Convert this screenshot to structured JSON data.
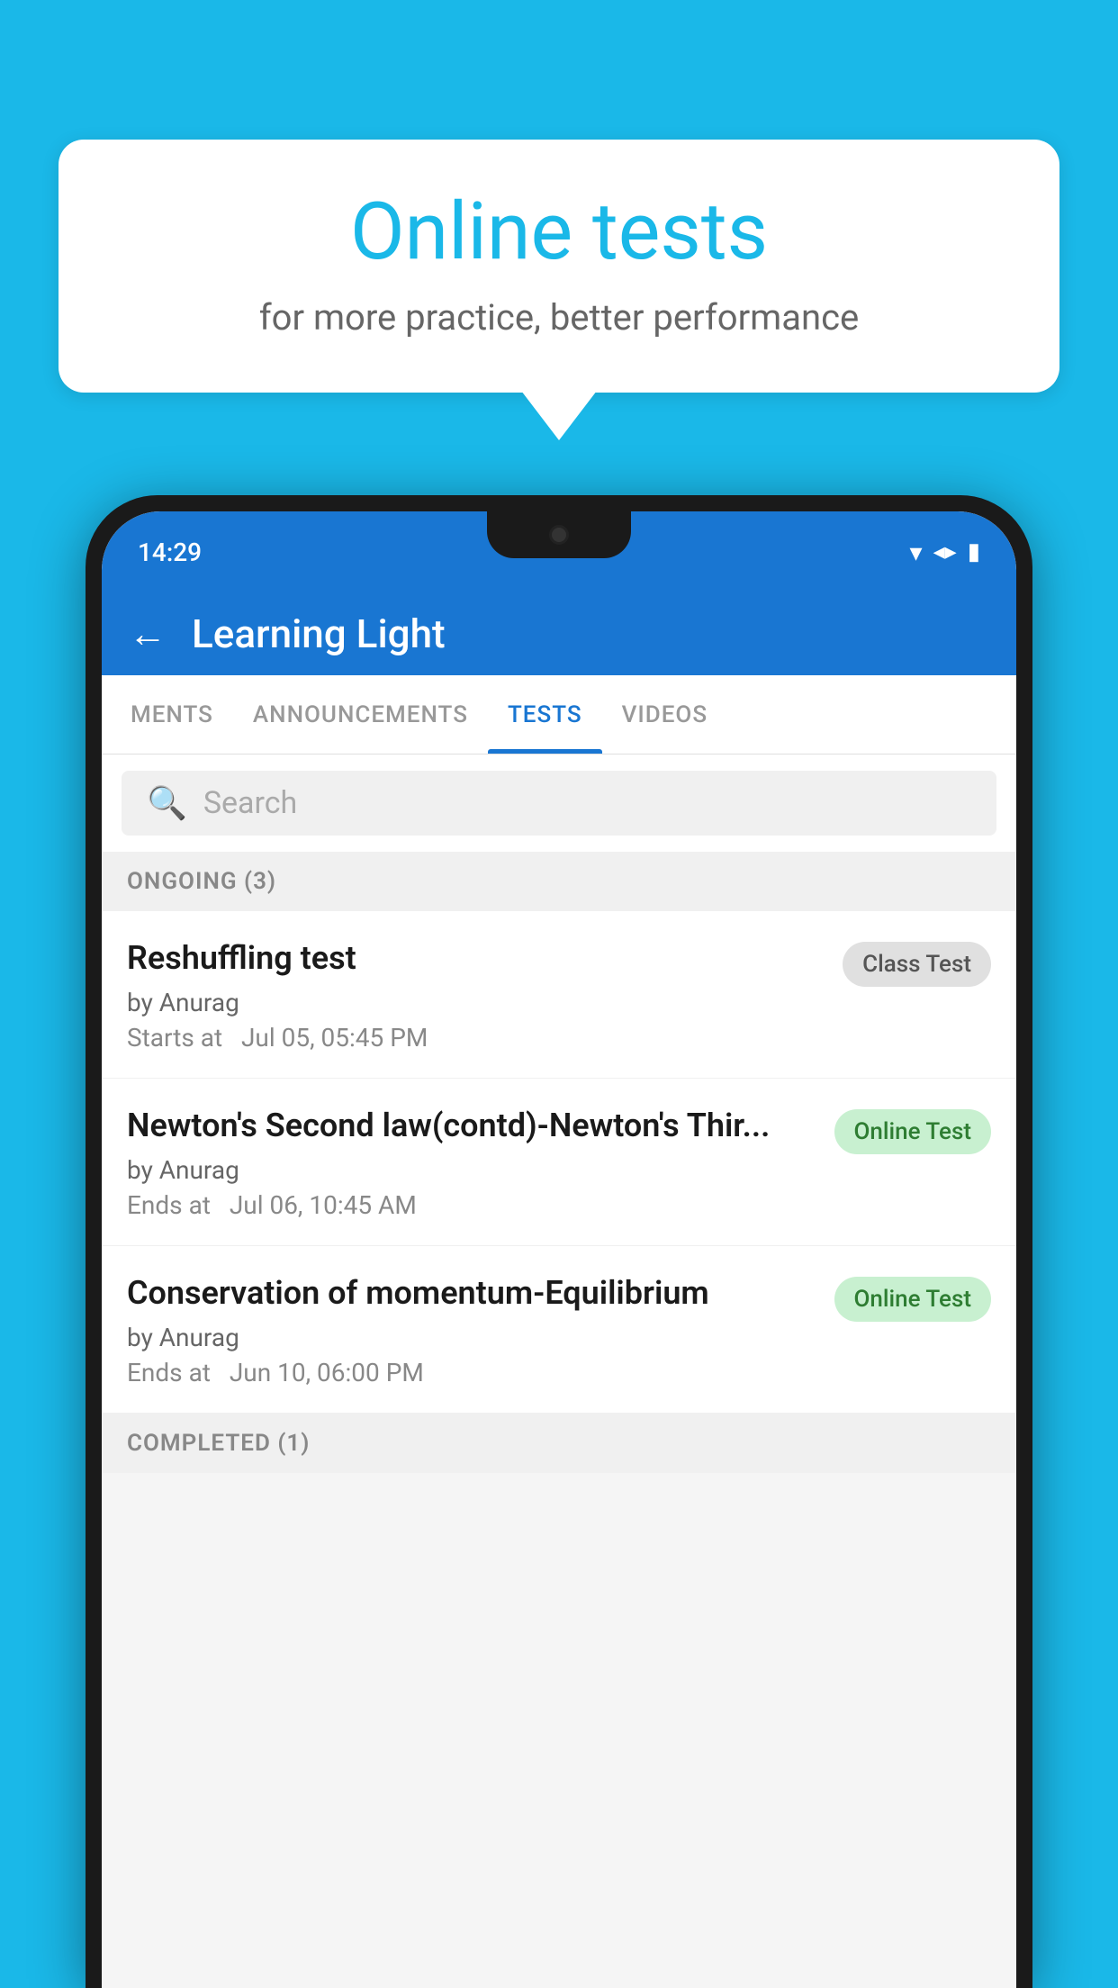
{
  "background_color": "#1ab8e8",
  "speech_bubble": {
    "title": "Online tests",
    "subtitle": "for more practice, better performance"
  },
  "phone": {
    "status_bar": {
      "time": "14:29",
      "wifi": "▾",
      "signal": "▲",
      "battery": "▮"
    },
    "header": {
      "back_label": "←",
      "title": "Learning Light"
    },
    "tabs": [
      {
        "label": "MENTS",
        "active": false
      },
      {
        "label": "ANNOUNCEMENTS",
        "active": false
      },
      {
        "label": "TESTS",
        "active": true
      },
      {
        "label": "VIDEOS",
        "active": false
      }
    ],
    "search": {
      "placeholder": "Search"
    },
    "ongoing_section": {
      "label": "ONGOING (3)"
    },
    "test_items": [
      {
        "name": "Reshuffling test",
        "author": "by Anurag",
        "time_label": "Starts at",
        "time": "Jul 05, 05:45 PM",
        "badge": "Class Test",
        "badge_type": "class"
      },
      {
        "name": "Newton's Second law(contd)-Newton's Thir...",
        "author": "by Anurag",
        "time_label": "Ends at",
        "time": "Jul 06, 10:45 AM",
        "badge": "Online Test",
        "badge_type": "online"
      },
      {
        "name": "Conservation of momentum-Equilibrium",
        "author": "by Anurag",
        "time_label": "Ends at",
        "time": "Jun 10, 06:00 PM",
        "badge": "Online Test",
        "badge_type": "online"
      }
    ],
    "completed_section": {
      "label": "COMPLETED (1)"
    }
  }
}
